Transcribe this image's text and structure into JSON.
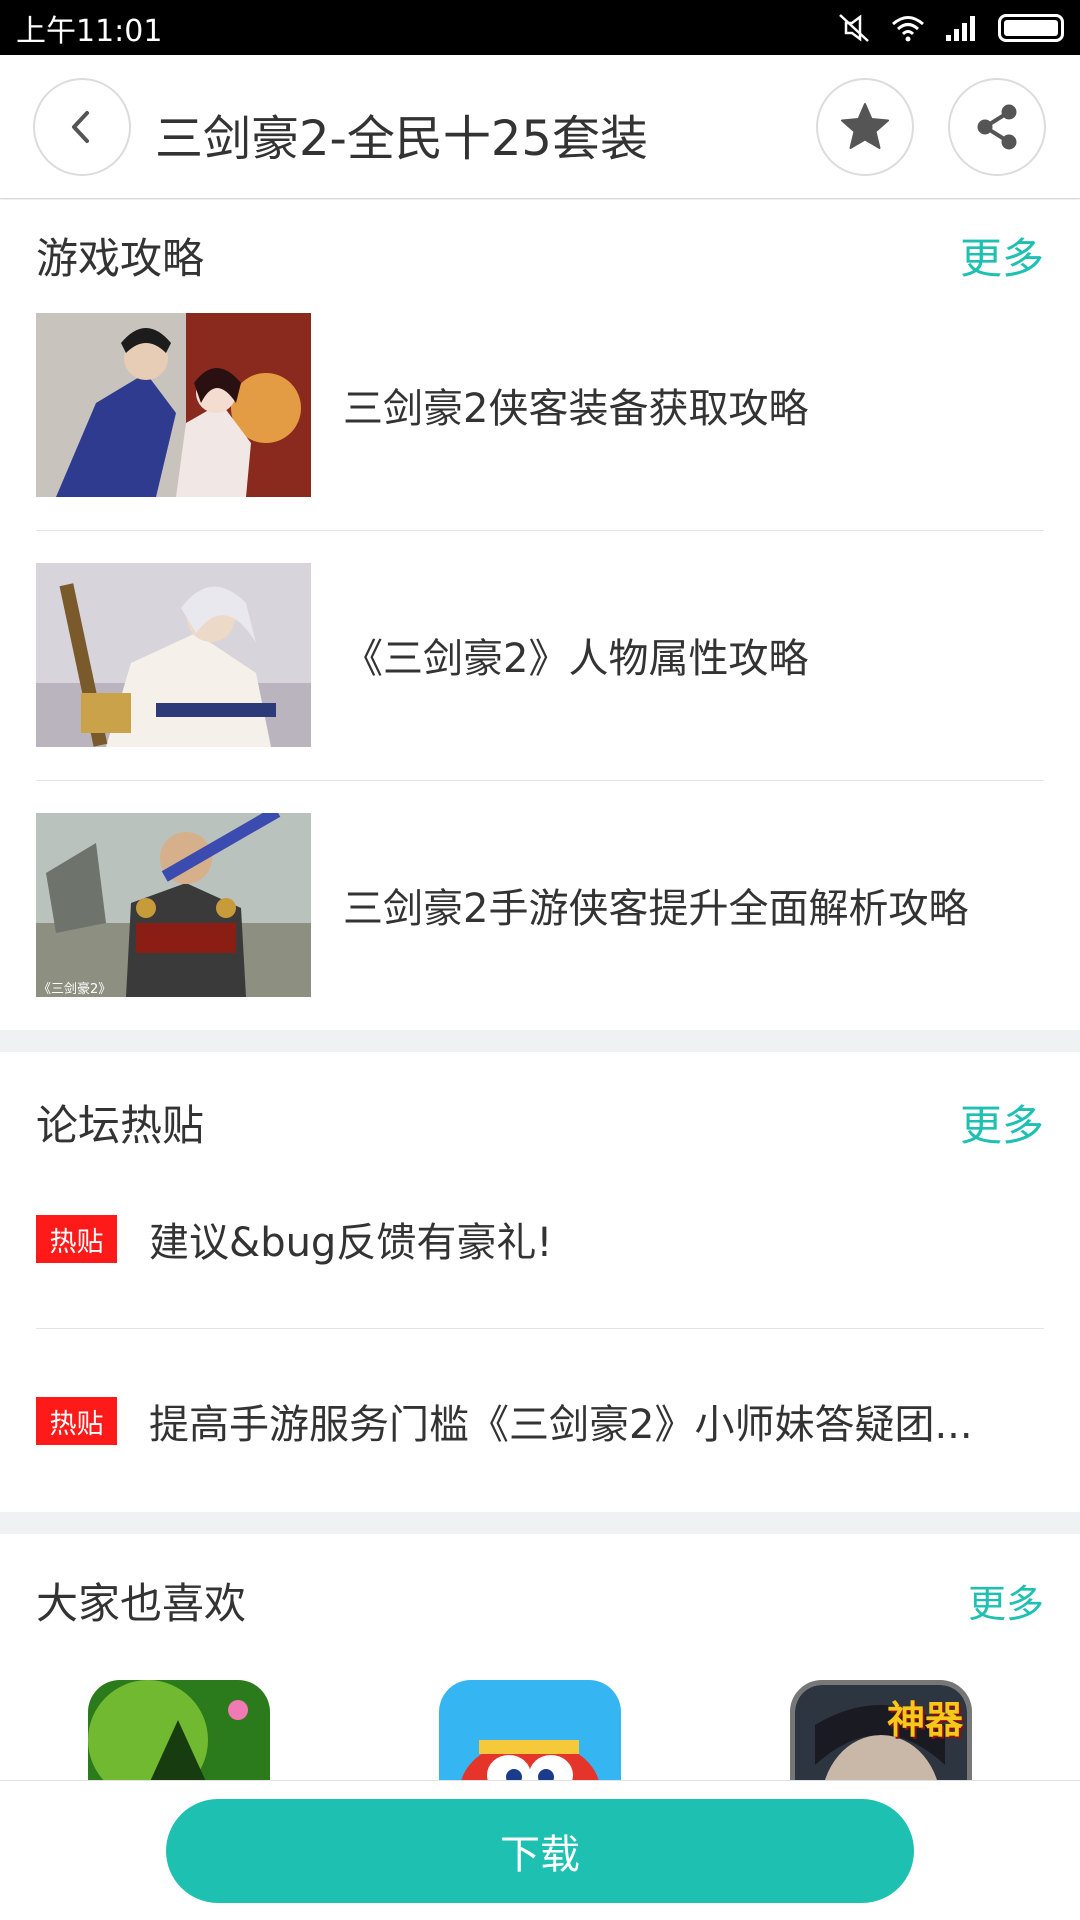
{
  "status_bar": {
    "time": "上午11:01"
  },
  "header": {
    "title": "三剑豪2-全民十25套装"
  },
  "guides": {
    "title": "游戏攻略",
    "more": "更多",
    "items": [
      {
        "title": "三剑豪2侠客装备获取攻略"
      },
      {
        "title": "《三剑豪2》人物属性攻略"
      },
      {
        "title": "三剑豪2手游侠客提升全面解析攻略"
      }
    ],
    "thumb3_caption": "《三剑豪2》"
  },
  "forum": {
    "title": "论坛热贴",
    "more": "更多",
    "items": [
      {
        "badge": "热贴",
        "title": "建议&bug反馈有豪礼!"
      },
      {
        "badge": "热贴",
        "title": "提高手游服务门槛《三剑豪2》小师妹答疑团..."
      }
    ]
  },
  "recommend": {
    "title": "大家也喜欢",
    "more": "更多",
    "icon3_text": "神器"
  },
  "bottom": {
    "download_label": "下载"
  },
  "colors": {
    "accent": "#1ec0b2",
    "hot_badge": "#ff1a1a"
  }
}
